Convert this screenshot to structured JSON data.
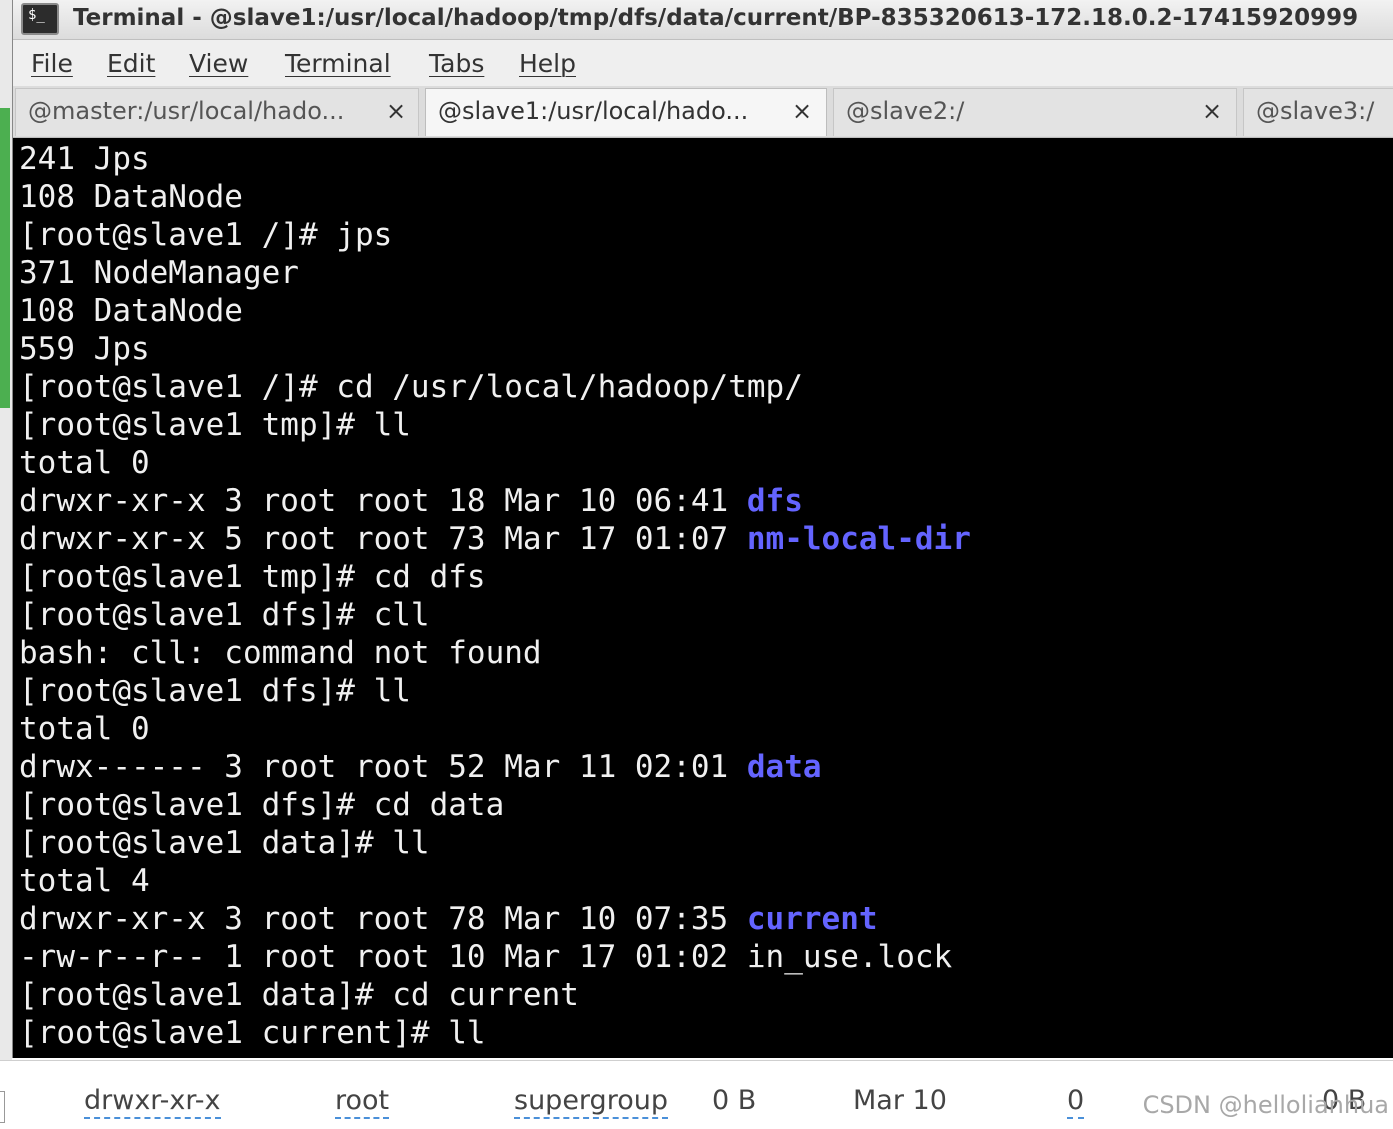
{
  "window": {
    "title": "Terminal - @slave1:/usr/local/hadoop/tmp/dfs/data/current/BP-835320613-172.18.0.2-17415920999"
  },
  "menu": [
    "File",
    "Edit",
    "View",
    "Terminal",
    "Tabs",
    "Help"
  ],
  "tabs": [
    {
      "label": "@master:/usr/local/hado...",
      "close": "×",
      "active": false
    },
    {
      "label": "@slave1:/usr/local/hado...",
      "close": "×",
      "active": true
    },
    {
      "label": "@slave2:/",
      "close": "×",
      "active": false
    },
    {
      "label": "@slave3:/",
      "close": "",
      "active": false
    }
  ],
  "terminal": {
    "lines": [
      [
        "241 Jps",
        ""
      ],
      [
        "108 DataNode",
        ""
      ],
      [
        "[root@slave1 /]# jps",
        ""
      ],
      [
        "371 NodeManager",
        ""
      ],
      [
        "108 DataNode",
        ""
      ],
      [
        "559 Jps",
        ""
      ],
      [
        "[root@slave1 /]# cd /usr/local/hadoop/tmp/",
        ""
      ],
      [
        "[root@slave1 tmp]# ll",
        ""
      ],
      [
        "total 0",
        ""
      ],
      [
        "drwxr-xr-x 3 root root 18 Mar 10 06:41 ",
        "dfs"
      ],
      [
        "drwxr-xr-x 5 root root 73 Mar 17 01:07 ",
        "nm-local-dir"
      ],
      [
        "[root@slave1 tmp]# cd dfs",
        ""
      ],
      [
        "[root@slave1 dfs]# cll",
        ""
      ],
      [
        "bash: cll: command not found",
        ""
      ],
      [
        "[root@slave1 dfs]# ll",
        ""
      ],
      [
        "total 0",
        ""
      ],
      [
        "drwx------ 3 root root 52 Mar 11 02:01 ",
        "data"
      ],
      [
        "[root@slave1 dfs]# cd data",
        ""
      ],
      [
        "[root@slave1 data]# ll",
        ""
      ],
      [
        "total 4",
        ""
      ],
      [
        "drwxr-xr-x 3 root root 78 Mar 10 07:35 ",
        "current"
      ],
      [
        "-rw-r--r-- 1 root root 10 Mar 17 01:02 in_use.lock",
        ""
      ],
      [
        "[root@slave1 data]# cd current",
        ""
      ],
      [
        "[root@slave1 current]# ll",
        ""
      ]
    ]
  },
  "file_row": {
    "permissions": "drwxr-xr-x",
    "owner": "root",
    "group": "supergroup",
    "size": "0 B",
    "modified": "Mar 10",
    "replication": "0",
    "block_size": "0 B"
  },
  "watermark": "CSDN @hellolianhua",
  "colors": {
    "terminal_bg": "#000000",
    "terminal_fg": "#f0f0f0",
    "directory": "#6464ff",
    "left_panel_accent": "#4caf50"
  },
  "icons": {
    "app": "terminal-icon",
    "tab_close": "close-icon"
  }
}
